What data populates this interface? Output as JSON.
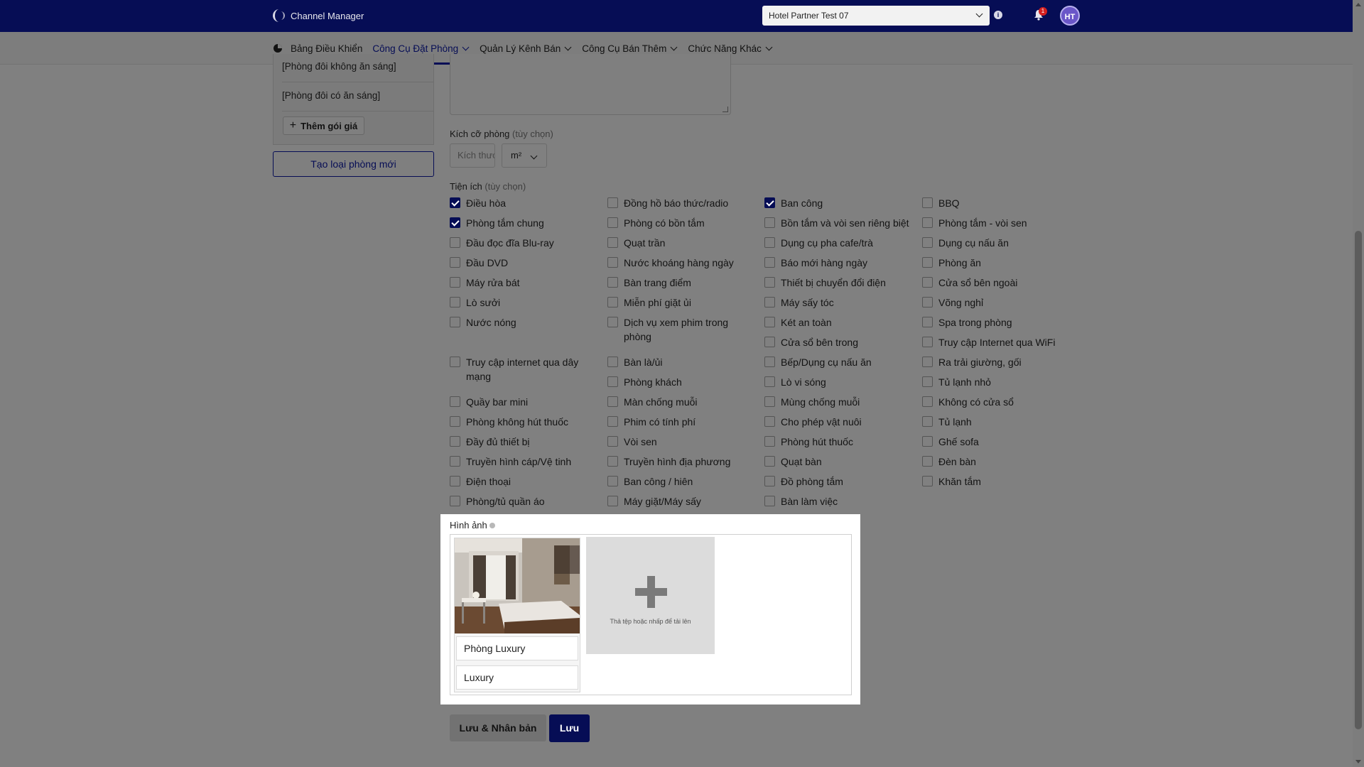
{
  "app": {
    "logo_text": "Channel Manager",
    "hotel_selected": "Hotel Partner Test 07",
    "notification_count": "1",
    "avatar_initials": "HT"
  },
  "nav": {
    "items": [
      {
        "label": "Bảng Điều Khiển",
        "has_dropdown": false,
        "active": false
      },
      {
        "label": "Công Cụ Đặt Phòng",
        "has_dropdown": true,
        "active": true
      },
      {
        "label": "Quản Lý Kênh Bán",
        "has_dropdown": true,
        "active": false
      },
      {
        "label": "Công Cụ Bán Thêm",
        "has_dropdown": true,
        "active": false
      },
      {
        "label": "Chức Năng Khác",
        "has_dropdown": true,
        "active": false
      }
    ]
  },
  "left": {
    "packages": [
      "[Phòng đôi không ăn sáng]",
      "[Phòng đôi có ăn sáng]"
    ],
    "add_package_label": "Thêm gói giá",
    "new_room_type_label": "Tạo loại phòng mới"
  },
  "form": {
    "room_size_label": "Kích cỡ phòng",
    "optional_label": "(tùy chọn)",
    "room_size_placeholder": "Kích thước",
    "room_size_unit": "m²",
    "amenities_label": "Tiện ích",
    "amenities": [
      [
        {
          "label": "Điều hòa",
          "checked": true
        },
        {
          "label": "Phòng tắm chung",
          "checked": true
        },
        {
          "label": "Đầu đọc đĩa Blu-ray",
          "checked": false
        },
        {
          "label": "Đầu DVD",
          "checked": false
        },
        {
          "label": "Máy rửa bát",
          "checked": false
        },
        {
          "label": "Lò sưởi",
          "checked": false
        },
        {
          "label": "Nước nóng",
          "checked": false
        },
        {
          "label": "Truy cập internet qua dây mạng",
          "checked": false
        },
        {
          "label": "Quầy bar mini",
          "checked": false
        },
        {
          "label": "Phòng không hút thuốc",
          "checked": false
        },
        {
          "label": "Đầy đủ thiết bị",
          "checked": false
        },
        {
          "label": "Truyền hình cáp/Vệ tinh",
          "checked": false
        },
        {
          "label": "Điện thoại",
          "checked": false
        },
        {
          "label": "Phòng/tủ quần áo",
          "checked": false
        }
      ],
      [
        {
          "label": "Đồng hồ báo thức/radio",
          "checked": false
        },
        {
          "label": "Phòng có bồn tắm",
          "checked": false
        },
        {
          "label": "Quạt trần",
          "checked": false
        },
        {
          "label": "Nước khoáng hàng ngày",
          "checked": false
        },
        {
          "label": "Bàn trang điểm",
          "checked": false
        },
        {
          "label": "Miễn phí giặt ủi",
          "checked": false
        },
        {
          "label": "Dịch vụ xem phim trong phòng",
          "checked": false
        },
        {
          "label": "Bàn là/ủi",
          "checked": false
        },
        {
          "label": "Phòng khách",
          "checked": false
        },
        {
          "label": "Màn chống muỗi",
          "checked": false
        },
        {
          "label": "Phim có tính phí",
          "checked": false
        },
        {
          "label": "Vòi sen",
          "checked": false
        },
        {
          "label": "Truyền hình địa phương",
          "checked": false
        },
        {
          "label": "Ban công / hiên",
          "checked": false
        },
        {
          "label": "Máy giặt/Máy sấy",
          "checked": false
        }
      ],
      [
        {
          "label": "Ban công",
          "checked": true
        },
        {
          "label": "Bồn tắm và vòi sen riêng biệt",
          "checked": false
        },
        {
          "label": "Dụng cụ pha cafe/trà",
          "checked": false
        },
        {
          "label": "Báo mới hàng ngày",
          "checked": false
        },
        {
          "label": "Thiết bị chuyển đổi điện",
          "checked": false
        },
        {
          "label": "Máy sấy tóc",
          "checked": false
        },
        {
          "label": "Két an toàn",
          "checked": false
        },
        {
          "label": "Cửa sổ bên trong",
          "checked": false
        },
        {
          "label": "Bếp/Dụng cụ nấu ăn",
          "checked": false
        },
        {
          "label": "Lò vi sóng",
          "checked": false
        },
        {
          "label": "Mùng chống muỗi",
          "checked": false
        },
        {
          "label": "Cho phép vật nuôi",
          "checked": false
        },
        {
          "label": "Phòng hút thuốc",
          "checked": false
        },
        {
          "label": "Quạt bàn",
          "checked": false
        },
        {
          "label": "Đồ phòng tắm",
          "checked": false
        },
        {
          "label": "Bàn làm việc",
          "checked": false
        }
      ],
      [
        {
          "label": "BBQ",
          "checked": false
        },
        {
          "label": "Phòng tắm - vòi sen",
          "checked": false
        },
        {
          "label": "Dụng cụ nấu ăn",
          "checked": false
        },
        {
          "label": "Phòng ăn",
          "checked": false
        },
        {
          "label": "Cửa sổ bên ngoài",
          "checked": false
        },
        {
          "label": "Võng nghỉ",
          "checked": false
        },
        {
          "label": "Spa trong phòng",
          "checked": false
        },
        {
          "label": "Truy cập Internet qua WiFi",
          "checked": false
        },
        {
          "label": "Ra trải giường, gối",
          "checked": false
        },
        {
          "label": "Tủ lạnh nhỏ",
          "checked": false
        },
        {
          "label": "Không có cửa sổ",
          "checked": false
        },
        {
          "label": "Tủ lạnh",
          "checked": false
        },
        {
          "label": "Ghế sofa",
          "checked": false
        },
        {
          "label": "Đèn bàn",
          "checked": false
        },
        {
          "label": "Khăn tắm",
          "checked": false
        }
      ]
    ]
  },
  "images": {
    "label": "Hình ảnh",
    "photos": [
      {
        "caption": "Phòng Luxury",
        "caption2": "Luxury"
      }
    ],
    "upload_text": "Thả tệp hoặc nhấp để tải lên"
  },
  "actions": {
    "save_duplicate_label": "Lưu & Nhân bản",
    "save_label": "Lưu"
  },
  "colors": {
    "brand": "#060d55",
    "checkbox_checked": "#060d55",
    "notification": "#d42020",
    "avatar": "#6a56c8"
  }
}
